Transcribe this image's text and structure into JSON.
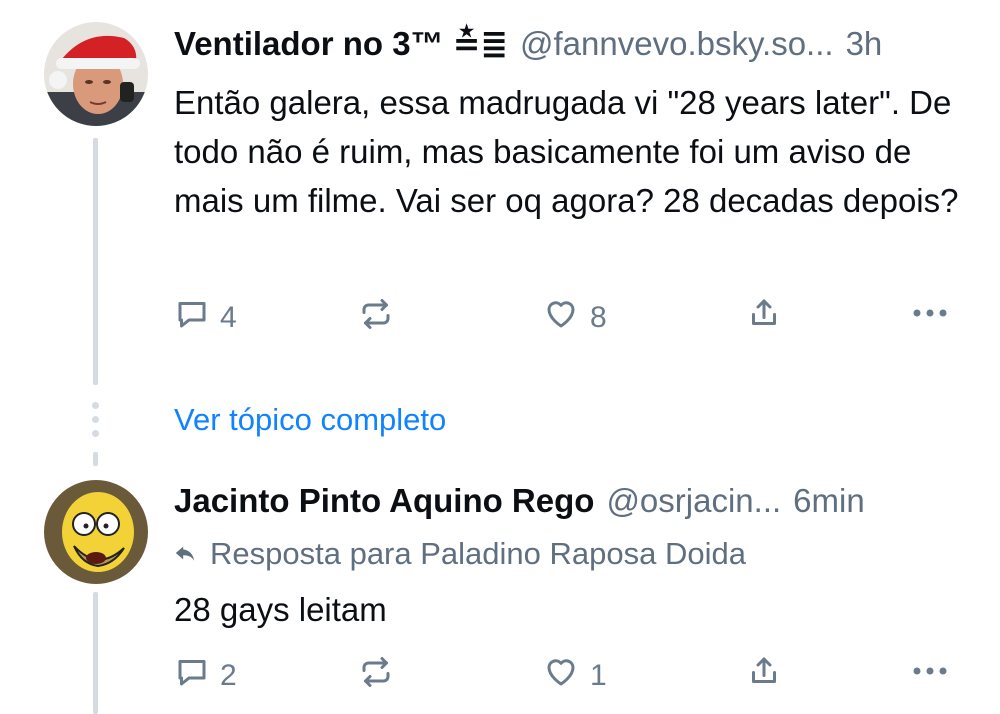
{
  "post1": {
    "display_name": "Ventilador no 3™ ≛≣",
    "handle": "@fannvevo.bsky.so...",
    "time": "3h",
    "text": "Então galera, essa madrugada vi \"28 years later\". De todo não é ruim, mas basicamente foi um aviso de mais um filme. Vai ser oq agora? 28 decadas depois?",
    "replies": "4",
    "likes": "8"
  },
  "thread": {
    "view_full_label": "Ver tópico completo"
  },
  "post2": {
    "display_name": "Jacinto Pinto Aquino Rego",
    "handle": "@osrjacin...",
    "time": "6min",
    "reply_to": "Resposta para Paladino Raposa Doida",
    "text": "28 gays leitam",
    "replies": "2",
    "likes": "1"
  },
  "colors": {
    "link": "#1083fe",
    "muted": "#5f6f80",
    "thread_line": "#d4dbe2"
  }
}
